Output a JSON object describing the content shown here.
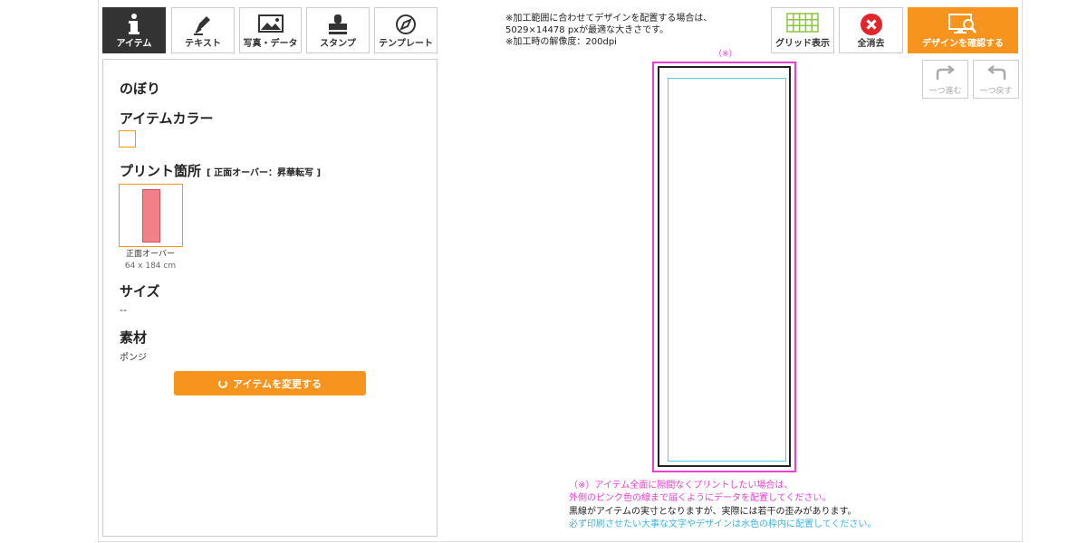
{
  "toolbar": {
    "tabs": [
      {
        "label": "アイテム",
        "icon": "info-icon",
        "active": true
      },
      {
        "label": "テキスト",
        "icon": "pen-icon",
        "active": false
      },
      {
        "label": "写真・データ",
        "icon": "image-icon",
        "active": false
      },
      {
        "label": "スタンプ",
        "icon": "stamp-icon",
        "active": false
      },
      {
        "label": "テンプレート",
        "icon": "compass-icon",
        "active": false
      }
    ]
  },
  "notice": {
    "line1": "※加工範囲に合わせてデザインを配置する場合は、",
    "line2": "5029×14478 pxが最適な大きさです。",
    "line3": "※加工時の解像度：200dpi"
  },
  "actions": {
    "grid_label": "グリッド表示",
    "clear_label": "全消去",
    "confirm_label": "デザインを確認する",
    "redo_label": "一つ進む",
    "undo_label": "一つ戻す"
  },
  "panel": {
    "item_name": "のぼり",
    "color_heading": "アイテムカラー",
    "print_heading": "プリント箇所",
    "print_sub": "[ 正面オーバー：昇華転写 ]",
    "print_caption": "正面オーバー",
    "print_size": "64 x 184 cm",
    "size_heading": "サイズ",
    "size_value": "--",
    "material_heading": "素材",
    "material_value": "ポンジ",
    "change_button": "アイテムを変更する"
  },
  "canvas": {
    "mark": "（※）",
    "note1": "（※）アイテム全面に隙間なくプリントしたい場合は、",
    "note2": "外側のピンク色の線まで届くようにデータを配置してください。",
    "note3": "黒線がアイテムの実寸となりますが、実際には若干の歪みがあります。",
    "note4": "必ず印刷させたい大事な文字やデザインは水色の枠内に配置してください。"
  },
  "colors": {
    "accent": "#f7941d",
    "pink": "#e940d0",
    "cyan": "#4fd1e0",
    "active_tab": "#333333"
  }
}
